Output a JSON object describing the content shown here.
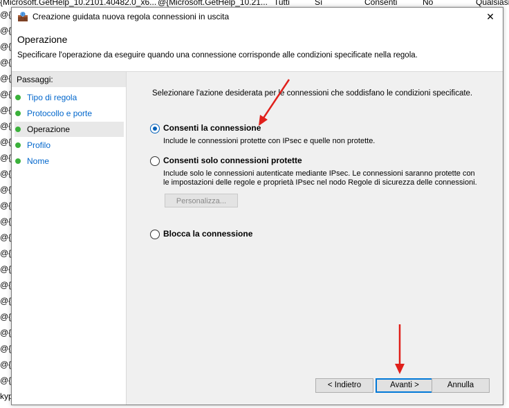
{
  "background": {
    "header_cells": [
      "{Microsoft.GetHelp_10.2101.40482.0_x6...",
      "@{Microsoft.GetHelp_10.21...",
      "Tutti",
      "Sì",
      "Consenti",
      "No",
      "Qualsiasi"
    ],
    "left_rows": [
      "@{M",
      "@{M",
      "@{M",
      "@{M",
      "@{M",
      "@{M",
      "@{M",
      "@{M",
      "@{M",
      "@{M",
      "@{M",
      "@{M",
      "@{M",
      "@{M",
      "@{M",
      "@{M",
      "@{M",
      "@{M",
      "@{M",
      "@{M",
      "@{M",
      "@{M",
      "@{M",
      "@{Fi",
      "kyp",
      "kyp"
    ]
  },
  "window": {
    "title": "Creazione guidata nuova regola connessioni in uscita",
    "close_label": "✕"
  },
  "header": {
    "title": "Operazione",
    "subtitle": "Specificare l'operazione da eseguire quando una connessione corrisponde alle condizioni specificate nella regola."
  },
  "steps": {
    "title": "Passaggi:",
    "items": [
      {
        "label": "Tipo di regola"
      },
      {
        "label": "Protocollo e porte"
      },
      {
        "label": "Operazione"
      },
      {
        "label": "Profilo"
      },
      {
        "label": "Nome"
      }
    ],
    "current_index": 2
  },
  "main": {
    "instruction": "Selezionare l'azione desiderata per le connessioni che soddisfano le condizioni specificate.",
    "options": [
      {
        "label": "Consenti la connessione",
        "desc": "Include le connessioni protette con IPsec e quelle non protette.",
        "checked": true
      },
      {
        "label": "Consenti solo connessioni protette",
        "desc_line1": "Include solo le connessioni autenticate mediante IPsec. Le connessioni saranno protette con",
        "desc_line2": "le impostazioni delle regole e proprietà IPsec nel nodo Regole di sicurezza delle connessioni.",
        "checked": false
      },
      {
        "label": "Blocca la connessione",
        "checked": false
      }
    ],
    "customize_label": "Personalizza..."
  },
  "footer": {
    "back_label": "< Indietro",
    "next_label": "Avanti >",
    "cancel_label": "Annulla"
  },
  "colors": {
    "accent": "#0078d7",
    "step_dot": "#3bb13b",
    "annotation_arrow": "#e0201b"
  }
}
